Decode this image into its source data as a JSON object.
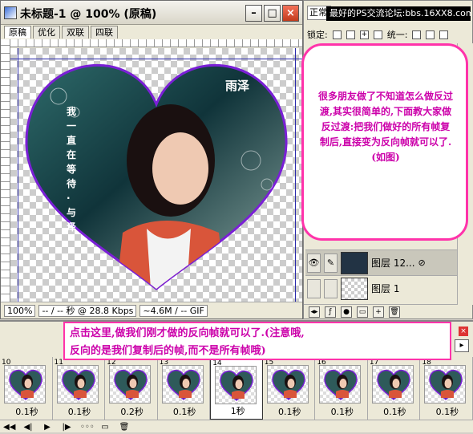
{
  "document": {
    "title": "未标题-1 @ 100% (原稿)",
    "tabs": [
      "原稿",
      "优化",
      "双联",
      "四联"
    ],
    "active_tab": 0,
    "zoom": "100%",
    "download": "-- / -- 秒 @ 28.8 Kbps",
    "format": "~4.6M / -- GIF",
    "canvas_text_vertical": "我一直在等待·与泽",
    "canvas_text_signature": "雨泽"
  },
  "layers_panel": {
    "blend_mode": "正常",
    "lock_label": "锁定:",
    "unify_label": "统一:",
    "layers": [
      {
        "name": "图层 12...",
        "visible": true,
        "selected": true
      },
      {
        "name": "图层 1",
        "visible": false,
        "selected": false
      }
    ]
  },
  "watermark": "最好的PS交流论坛:bbs.16XX8.com",
  "note_top": "很多朋友做了不知道怎么做反过渡,其实很简单的,下面教大家做反过渡:把我们做好的所有帧复制后,直接变为反向帧就可以了.(如图)",
  "note_bottom": {
    "line1": "点击这里,做我们刚才做的反向帧就可以了.(注意哦,",
    "line2": "反向的是我们复制后的帧,而不是所有帧哦)"
  },
  "frames": [
    {
      "num": "10",
      "delay": "0.1秒",
      "selected": false
    },
    {
      "num": "11",
      "delay": "0.1秒",
      "selected": false
    },
    {
      "num": "12",
      "delay": "0.2秒",
      "selected": false
    },
    {
      "num": "13",
      "delay": "0.1秒",
      "selected": false
    },
    {
      "num": "14",
      "delay": "1秒",
      "selected": true
    },
    {
      "num": "15",
      "delay": "0.1秒",
      "selected": false
    },
    {
      "num": "16",
      "delay": "0.1秒",
      "selected": false
    },
    {
      "num": "17",
      "delay": "0.1秒",
      "selected": false
    },
    {
      "num": "18",
      "delay": "0.1秒",
      "selected": false
    }
  ],
  "colors": {
    "note_border": "#ff33aa",
    "note_text": "#cc00aa",
    "heart_border": "#7a1fd6"
  }
}
